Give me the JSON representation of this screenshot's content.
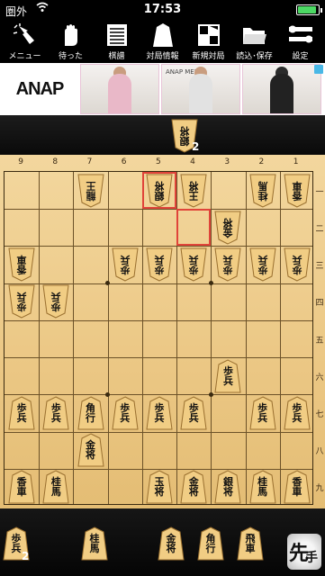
{
  "status_bar": {
    "carrier": "圏外",
    "time": "17:53",
    "wifi_icon": "wifi-icon",
    "battery_level": 0.9
  },
  "toolbar": {
    "items": [
      {
        "id": "menu",
        "label": "メニュー",
        "icon": "hand-pointer-icon"
      },
      {
        "id": "undo",
        "label": "待った",
        "icon": "open-hand-icon"
      },
      {
        "id": "kifu",
        "label": "棋譜",
        "icon": "list-icon"
      },
      {
        "id": "info",
        "label": "対局情報",
        "icon": "piece-icon"
      },
      {
        "id": "new",
        "label": "新規対局",
        "icon": "board-icon"
      },
      {
        "id": "load",
        "label": "読込･保存",
        "icon": "folder-icon"
      },
      {
        "id": "settings",
        "label": "設定",
        "icon": "tools-icon"
      }
    ]
  },
  "ad": {
    "brand": "ANAP",
    "photo_captions": [
      "",
      "ANAP MEN",
      ""
    ],
    "adchoices_icon": "adchoices-icon"
  },
  "board": {
    "files": [
      "9",
      "8",
      "7",
      "6",
      "5",
      "4",
      "3",
      "2",
      "1"
    ],
    "ranks": [
      "一",
      "二",
      "三",
      "四",
      "五",
      "六",
      "七",
      "八",
      "九"
    ],
    "highlight_squares": [
      "5一",
      "4二"
    ],
    "pieces": [
      {
        "side": "gote",
        "sq": "7一",
        "kanji": "龍王",
        "promoted": true
      },
      {
        "side": "gote",
        "sq": "5一",
        "kanji": "銀将"
      },
      {
        "side": "gote",
        "sq": "4一",
        "kanji": "王将"
      },
      {
        "side": "gote",
        "sq": "2一",
        "kanji": "桂馬"
      },
      {
        "side": "gote",
        "sq": "1一",
        "kanji": "香車"
      },
      {
        "side": "gote",
        "sq": "3二",
        "kanji": "金将"
      },
      {
        "side": "gote",
        "sq": "9三",
        "kanji": "香車"
      },
      {
        "side": "gote",
        "sq": "6三",
        "kanji": "歩兵"
      },
      {
        "side": "gote",
        "sq": "5三",
        "kanji": "歩兵"
      },
      {
        "side": "gote",
        "sq": "4三",
        "kanji": "歩兵"
      },
      {
        "side": "gote",
        "sq": "3三",
        "kanji": "歩兵"
      },
      {
        "side": "gote",
        "sq": "2三",
        "kanji": "歩兵"
      },
      {
        "side": "gote",
        "sq": "1三",
        "kanji": "歩兵"
      },
      {
        "side": "gote",
        "sq": "9四",
        "kanji": "歩兵"
      },
      {
        "side": "gote",
        "sq": "8四",
        "kanji": "歩兵"
      },
      {
        "side": "sente",
        "sq": "3六",
        "kanji": "歩兵"
      },
      {
        "side": "sente",
        "sq": "9七",
        "kanji": "歩兵"
      },
      {
        "side": "sente",
        "sq": "8七",
        "kanji": "歩兵"
      },
      {
        "side": "sente",
        "sq": "7七",
        "kanji": "角行"
      },
      {
        "side": "sente",
        "sq": "6七",
        "kanji": "歩兵"
      },
      {
        "side": "sente",
        "sq": "5七",
        "kanji": "歩兵"
      },
      {
        "side": "sente",
        "sq": "4七",
        "kanji": "歩兵"
      },
      {
        "side": "sente",
        "sq": "2七",
        "kanji": "歩兵"
      },
      {
        "side": "sente",
        "sq": "1七",
        "kanji": "歩兵"
      },
      {
        "side": "sente",
        "sq": "7八",
        "kanji": "金将"
      },
      {
        "side": "sente",
        "sq": "9九",
        "kanji": "香車"
      },
      {
        "side": "sente",
        "sq": "8九",
        "kanji": "桂馬"
      },
      {
        "side": "sente",
        "sq": "5九",
        "kanji": "玉将"
      },
      {
        "side": "sente",
        "sq": "4九",
        "kanji": "金将"
      },
      {
        "side": "sente",
        "sq": "3九",
        "kanji": "銀将"
      },
      {
        "side": "sente",
        "sq": "2九",
        "kanji": "桂馬"
      },
      {
        "side": "sente",
        "sq": "1九",
        "kanji": "香車"
      }
    ]
  },
  "gote_hand": [
    {
      "kanji": "銀将",
      "count": "2"
    }
  ],
  "sente_hand": [
    {
      "kanji": "歩兵",
      "count": "2"
    },
    {
      "kanji": "桂馬",
      "count": ""
    },
    {
      "kanji": "金将",
      "count": ""
    },
    {
      "kanji": "角行",
      "count": ""
    },
    {
      "kanji": "飛車",
      "count": ""
    }
  ],
  "turn_indicator": {
    "main": "先",
    "sub": "手"
  }
}
